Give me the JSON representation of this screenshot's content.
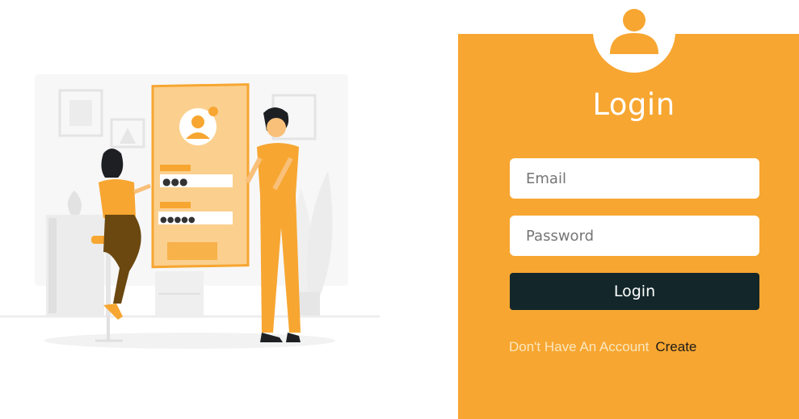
{
  "login": {
    "title": "Login",
    "email_placeholder": "Email",
    "password_placeholder": "Password",
    "button_label": "Login",
    "signup_prompt": "Don't Have An Account",
    "signup_link": "Create"
  },
  "colors": {
    "accent": "#f7a631",
    "button": "#13272a",
    "field_bg": "#ffffff",
    "illustration_dark": "#5a3b0d"
  },
  "icons": {
    "avatar": "user-avatar-icon",
    "illustration": "login-illustration"
  }
}
